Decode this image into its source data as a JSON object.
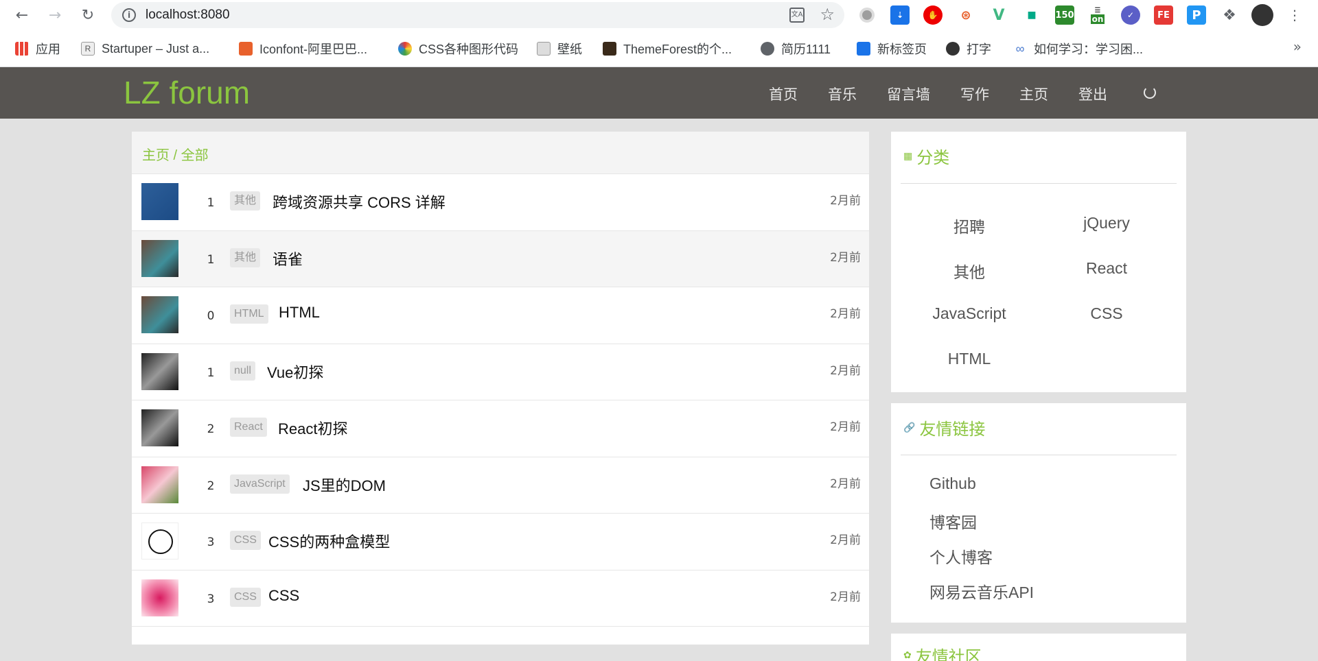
{
  "browser": {
    "url": "localhost:8080",
    "bookmarks": [
      "应用",
      "Startuper – Just a...",
      "Iconfont-阿里巴巴...",
      "CSS各种图形代码",
      "壁纸",
      "ThemeForest的个...",
      "简历1111",
      "新标签页",
      "打字",
      "如何学习：学习困..."
    ],
    "bookmarks_more": "»",
    "extensions": [
      "150",
      "on",
      "FE",
      "P"
    ]
  },
  "site": {
    "logo": "LZ forum",
    "nav": [
      "首页",
      "音乐",
      "留言墙",
      "写作",
      "主页",
      "登出"
    ]
  },
  "breadcrumb": "主页 / 全部",
  "posts": [
    {
      "count": "1",
      "category": "其他",
      "title": "跨域资源共享 CORS 详解",
      "time": "2月前"
    },
    {
      "count": "1",
      "category": "其他",
      "title": "语雀",
      "time": "2月前"
    },
    {
      "count": "0",
      "category": "HTML",
      "title": "HTML",
      "time": "2月前"
    },
    {
      "count": "1",
      "category": "null",
      "title": "Vue初探",
      "time": "2月前"
    },
    {
      "count": "2",
      "category": "React",
      "title": "React初探",
      "time": "2月前"
    },
    {
      "count": "2",
      "category": "JavaScript",
      "title": "JS里的DOM",
      "time": "2月前"
    },
    {
      "count": "3",
      "category": "CSS",
      "title": "CSS的两种盒模型",
      "time": "2月前"
    },
    {
      "count": "3",
      "category": "CSS",
      "title": "CSS",
      "time": "2月前"
    }
  ],
  "sidebar": {
    "categories_title": "分类",
    "categories": [
      "招聘",
      "jQuery",
      "其他",
      "React",
      "JavaScript",
      "CSS",
      "HTML"
    ],
    "links_title": "友情链接",
    "links": [
      "Github",
      "博客园",
      "个人博客",
      "网易云音乐API"
    ],
    "community_title": "友情社区"
  },
  "colors": {
    "accent": "#8bc53f",
    "header_bg": "#575451",
    "page_bg": "#e1e1e1"
  }
}
